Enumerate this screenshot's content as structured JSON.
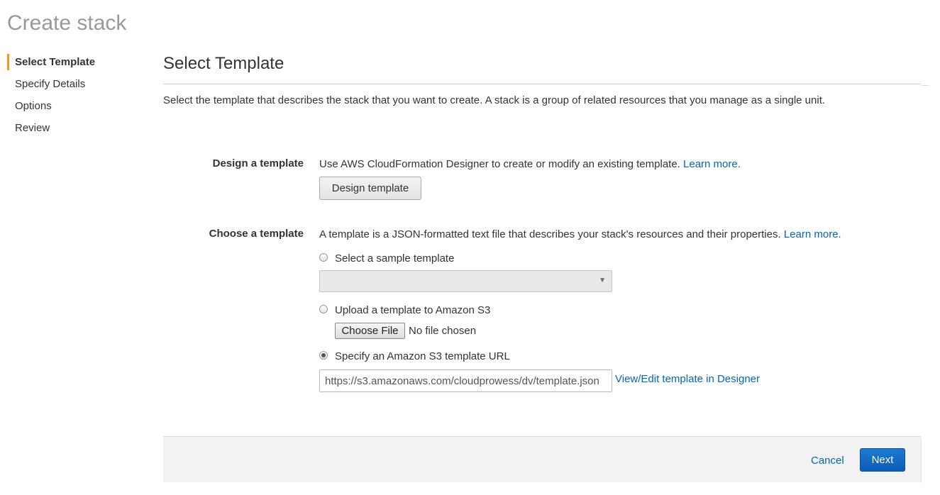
{
  "page": {
    "title": "Create stack"
  },
  "sidebar": {
    "items": [
      {
        "label": "Select Template",
        "active": true
      },
      {
        "label": "Specify Details",
        "active": false
      },
      {
        "label": "Options",
        "active": false
      },
      {
        "label": "Review",
        "active": false
      }
    ]
  },
  "main": {
    "title": "Select Template",
    "intro": "Select the template that describes the stack that you want to create. A stack is a group of related resources that you manage as a single unit.",
    "design": {
      "label": "Design a template",
      "description": "Use AWS CloudFormation Designer to create or modify an existing template.",
      "learn_more": "Learn more.",
      "button": "Design template"
    },
    "choose": {
      "label": "Choose a template",
      "description": "A template is a JSON-formatted text file that describes your stack's resources and their properties.",
      "learn_more": "Learn more.",
      "options": {
        "sample": {
          "label": "Select a sample template",
          "checked": false
        },
        "upload": {
          "label": "Upload a template to Amazon S3",
          "checked": false
        },
        "url": {
          "label": "Specify an Amazon S3 template URL",
          "checked": true
        }
      },
      "sample_select_value": "",
      "file_button": "Choose File",
      "file_status": "No file chosen",
      "url_value": "https://s3.amazonaws.com/cloudprowess/dv/template.json",
      "designer_link": "View/Edit template in Designer"
    }
  },
  "footer": {
    "cancel": "Cancel",
    "next": "Next"
  },
  "colors": {
    "accent": "#f7981d",
    "link": "#0066bb",
    "primary_button": "#0b5cb5"
  }
}
